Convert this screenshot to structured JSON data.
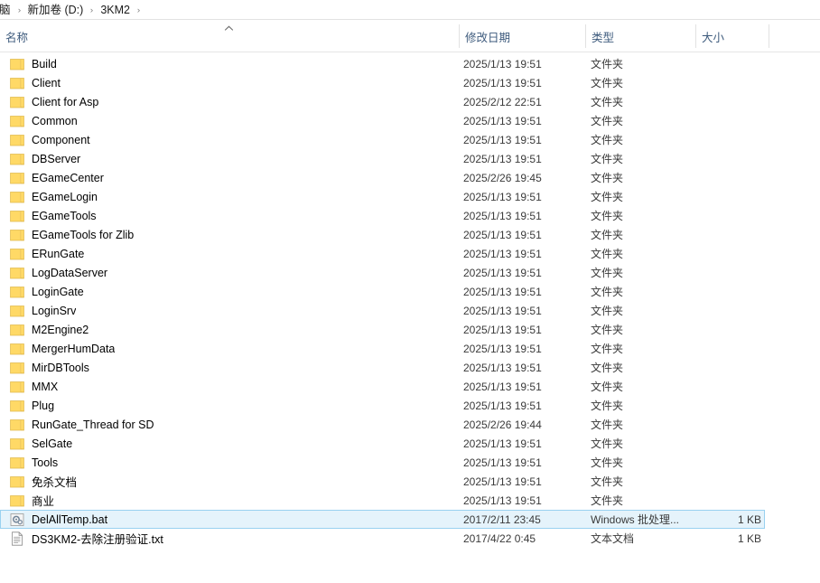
{
  "window": {
    "type": "file-explorer",
    "selection_color": "#e5f3fb",
    "selection_border_color": "#99d1f0",
    "folder_icon_color": "#ffd966"
  },
  "breadcrumb": {
    "separator": "›",
    "items": [
      {
        "label": "脑",
        "truncated": true
      },
      {
        "label": "新加卷 (D:)",
        "truncated": false
      },
      {
        "label": "3KM2",
        "truncated": false
      }
    ]
  },
  "columns": {
    "name": "名称",
    "date_modified": "修改日期",
    "type": "类型",
    "size": "大小",
    "sort_icon": "chevron-up-icon",
    "sorted_by": "名称",
    "sort_direction": "ascending"
  },
  "files": [
    {
      "name": "Build",
      "date": "2025/1/13 19:51",
      "type": "文件夹",
      "size": "",
      "icon": "folder-icon",
      "selected": false
    },
    {
      "name": "Client",
      "date": "2025/1/13 19:51",
      "type": "文件夹",
      "size": "",
      "icon": "folder-icon",
      "selected": false
    },
    {
      "name": "Client for Asp",
      "date": "2025/2/12 22:51",
      "type": "文件夹",
      "size": "",
      "icon": "folder-icon",
      "selected": false
    },
    {
      "name": "Common",
      "date": "2025/1/13 19:51",
      "type": "文件夹",
      "size": "",
      "icon": "folder-icon",
      "selected": false
    },
    {
      "name": "Component",
      "date": "2025/1/13 19:51",
      "type": "文件夹",
      "size": "",
      "icon": "folder-icon",
      "selected": false
    },
    {
      "name": "DBServer",
      "date": "2025/1/13 19:51",
      "type": "文件夹",
      "size": "",
      "icon": "folder-icon",
      "selected": false
    },
    {
      "name": "EGameCenter",
      "date": "2025/2/26 19:45",
      "type": "文件夹",
      "size": "",
      "icon": "folder-icon",
      "selected": false
    },
    {
      "name": "EGameLogin",
      "date": "2025/1/13 19:51",
      "type": "文件夹",
      "size": "",
      "icon": "folder-icon",
      "selected": false
    },
    {
      "name": "EGameTools",
      "date": "2025/1/13 19:51",
      "type": "文件夹",
      "size": "",
      "icon": "folder-icon",
      "selected": false
    },
    {
      "name": "EGameTools for Zlib",
      "date": "2025/1/13 19:51",
      "type": "文件夹",
      "size": "",
      "icon": "folder-icon",
      "selected": false
    },
    {
      "name": "ERunGate",
      "date": "2025/1/13 19:51",
      "type": "文件夹",
      "size": "",
      "icon": "folder-icon",
      "selected": false
    },
    {
      "name": "LogDataServer",
      "date": "2025/1/13 19:51",
      "type": "文件夹",
      "size": "",
      "icon": "folder-icon",
      "selected": false
    },
    {
      "name": "LoginGate",
      "date": "2025/1/13 19:51",
      "type": "文件夹",
      "size": "",
      "icon": "folder-icon",
      "selected": false
    },
    {
      "name": "LoginSrv",
      "date": "2025/1/13 19:51",
      "type": "文件夹",
      "size": "",
      "icon": "folder-icon",
      "selected": false
    },
    {
      "name": "M2Engine2",
      "date": "2025/1/13 19:51",
      "type": "文件夹",
      "size": "",
      "icon": "folder-icon",
      "selected": false
    },
    {
      "name": "MergerHumData",
      "date": "2025/1/13 19:51",
      "type": "文件夹",
      "size": "",
      "icon": "folder-icon",
      "selected": false
    },
    {
      "name": "MirDBTools",
      "date": "2025/1/13 19:51",
      "type": "文件夹",
      "size": "",
      "icon": "folder-icon",
      "selected": false
    },
    {
      "name": "MMX",
      "date": "2025/1/13 19:51",
      "type": "文件夹",
      "size": "",
      "icon": "folder-icon",
      "selected": false
    },
    {
      "name": "Plug",
      "date": "2025/1/13 19:51",
      "type": "文件夹",
      "size": "",
      "icon": "folder-icon",
      "selected": false
    },
    {
      "name": "RunGate_Thread for SD",
      "date": "2025/2/26 19:44",
      "type": "文件夹",
      "size": "",
      "icon": "folder-icon",
      "selected": false
    },
    {
      "name": "SelGate",
      "date": "2025/1/13 19:51",
      "type": "文件夹",
      "size": "",
      "icon": "folder-icon",
      "selected": false
    },
    {
      "name": "Tools",
      "date": "2025/1/13 19:51",
      "type": "文件夹",
      "size": "",
      "icon": "folder-icon",
      "selected": false
    },
    {
      "name": "免杀文档",
      "date": "2025/1/13 19:51",
      "type": "文件夹",
      "size": "",
      "icon": "folder-icon",
      "selected": false
    },
    {
      "name": "商业",
      "date": "2025/1/13 19:51",
      "type": "文件夹",
      "size": "",
      "icon": "folder-icon",
      "selected": false
    },
    {
      "name": "DelAllTemp.bat",
      "date": "2017/2/11 23:45",
      "type": "Windows 批处理...",
      "size": "1 KB",
      "icon": "bat-file-icon",
      "selected": true
    },
    {
      "name": "DS3KM2-去除注册验证.txt",
      "date": "2017/4/22 0:45",
      "type": "文本文档",
      "size": "1 KB",
      "icon": "text-file-icon",
      "selected": false
    }
  ]
}
